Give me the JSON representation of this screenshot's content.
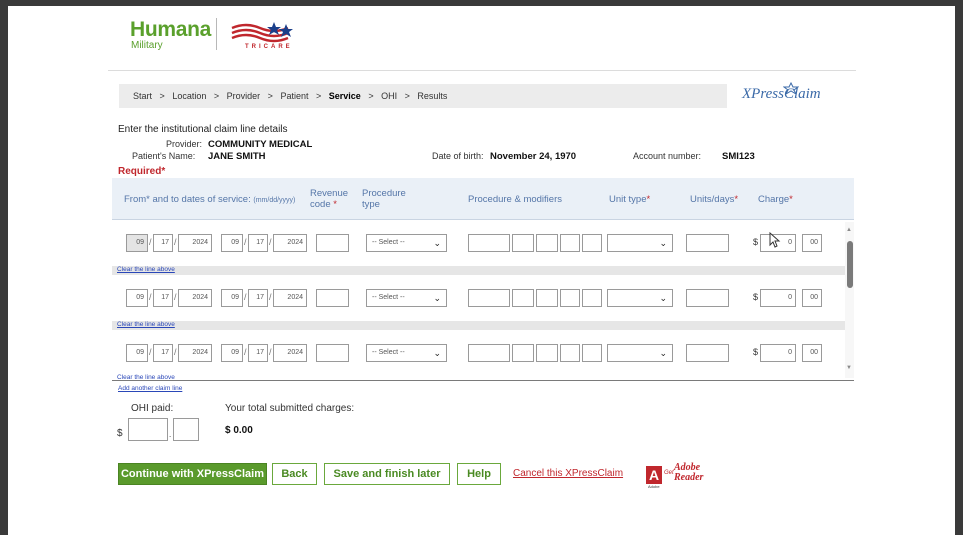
{
  "header": {
    "brand": "Humana",
    "brand_sub": "Military",
    "tricare_text": "TRICARE",
    "xpress_logo": "XPressClaim"
  },
  "breadcrumb": {
    "items": [
      "Start",
      ">",
      "Location",
      ">",
      "Provider",
      ">",
      "Patient",
      ">",
      "Service",
      ">",
      "OHI",
      ">",
      "Results"
    ],
    "current": "Service"
  },
  "claim": {
    "intro": "Enter the institutional claim line details",
    "provider_label": "Provider:",
    "provider_value": "COMMUNITY MEDICAL",
    "patient_label": "Patient's Name:",
    "patient_value": "JANE SMITH",
    "dob_label": "Date of birth:",
    "dob_value": "November 24, 1970",
    "account_label": "Account number:",
    "account_value": "SMI123",
    "required": "Required*"
  },
  "table": {
    "col_dates": "From* and to dates of service:",
    "col_dates_hint": "(mm/dd/yyyy)",
    "col_revenue_1": "Revenue",
    "col_revenue_2": "code",
    "col_procedure_type_1": "Procedure",
    "col_procedure_type_2": "type",
    "col_procedure_mod": "Procedure & modifiers",
    "col_unit_type": "Unit type",
    "col_units_days": "Units/days",
    "col_charge": "Charge",
    "star": "*",
    "rows": [
      {
        "from_mm": "09",
        "from_dd": "17",
        "from_yyyy": "2024",
        "to_mm": "09",
        "to_dd": "17",
        "to_yyyy": "2024",
        "proc_type": "-- Select --",
        "dollar": "$",
        "charge": "0",
        "cents": "00"
      },
      {
        "from_mm": "09",
        "from_dd": "17",
        "from_yyyy": "2024",
        "to_mm": "09",
        "to_dd": "17",
        "to_yyyy": "2024",
        "proc_type": "-- Select --",
        "dollar": "$",
        "charge": "0",
        "cents": "00"
      },
      {
        "from_mm": "09",
        "from_dd": "17",
        "from_yyyy": "2024",
        "to_mm": "09",
        "to_dd": "17",
        "to_yyyy": "2024",
        "proc_type": "-- Select --",
        "dollar": "$",
        "charge": "0",
        "cents": "00"
      }
    ],
    "clear_link": "Clear the line above",
    "add_link": "Add another claim line"
  },
  "summary": {
    "ohi_label": "OHI paid:",
    "total_label": "Your total submitted charges:",
    "dollar": "$",
    "total_value": "$ 0.00"
  },
  "buttons": {
    "continue": "Continue with XPressClaim",
    "back": "Back",
    "save": "Save and finish later",
    "help": "Help",
    "cancel": "Cancel this XPressClaim"
  },
  "adobe": {
    "get": "Get",
    "line1": "Adobe",
    "line2": "Reader",
    "brand": "Adobe"
  },
  "icons": {
    "dropdown": "chevron-down-icon",
    "scroll_up": "triangle-up-icon",
    "scroll_down": "triangle-down-icon"
  }
}
